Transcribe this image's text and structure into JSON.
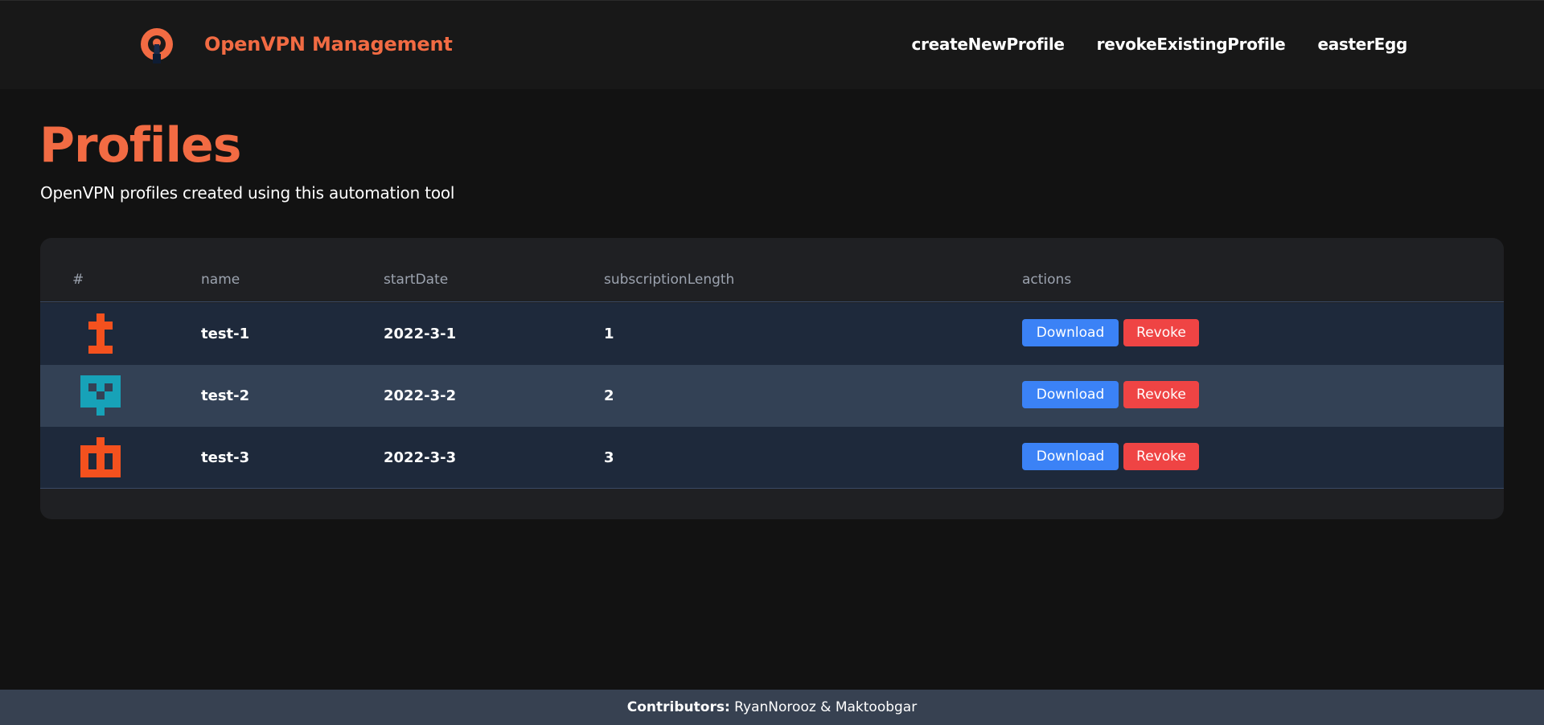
{
  "header": {
    "brand_title": "OpenVPN Management",
    "logo_icon": "openvpn-keyhole-logo",
    "nav": [
      {
        "label": "createNewProfile"
      },
      {
        "label": "revokeExistingProfile"
      },
      {
        "label": "easterEgg"
      }
    ]
  },
  "main": {
    "title": "Profiles",
    "subtitle": "OpenVPN profiles created using this automation tool"
  },
  "table": {
    "columns": [
      "#",
      "name",
      "startDate",
      "subscriptionLength",
      "actions"
    ],
    "rows": [
      {
        "avatar": "identicon-orange",
        "name": "test-1",
        "startDate": "2022-3-1",
        "subscriptionLength": "1",
        "download_label": "Download",
        "revoke_label": "Revoke"
      },
      {
        "avatar": "identicon-teal",
        "name": "test-2",
        "startDate": "2022-3-2",
        "subscriptionLength": "2",
        "download_label": "Download",
        "revoke_label": "Revoke"
      },
      {
        "avatar": "identicon-orange",
        "name": "test-3",
        "startDate": "2022-3-3",
        "subscriptionLength": "3",
        "download_label": "Download",
        "revoke_label": "Revoke"
      }
    ]
  },
  "footer": {
    "label": "Contributors:",
    "names": "RyanNorooz & Maktoobgar"
  },
  "colors": {
    "accent": "#f26b43",
    "background": "#121212",
    "download_button": "#3b82f6",
    "revoke_button": "#ef4444",
    "identicon_orange": "#f4511e",
    "identicon_teal": "#17a2b8"
  }
}
